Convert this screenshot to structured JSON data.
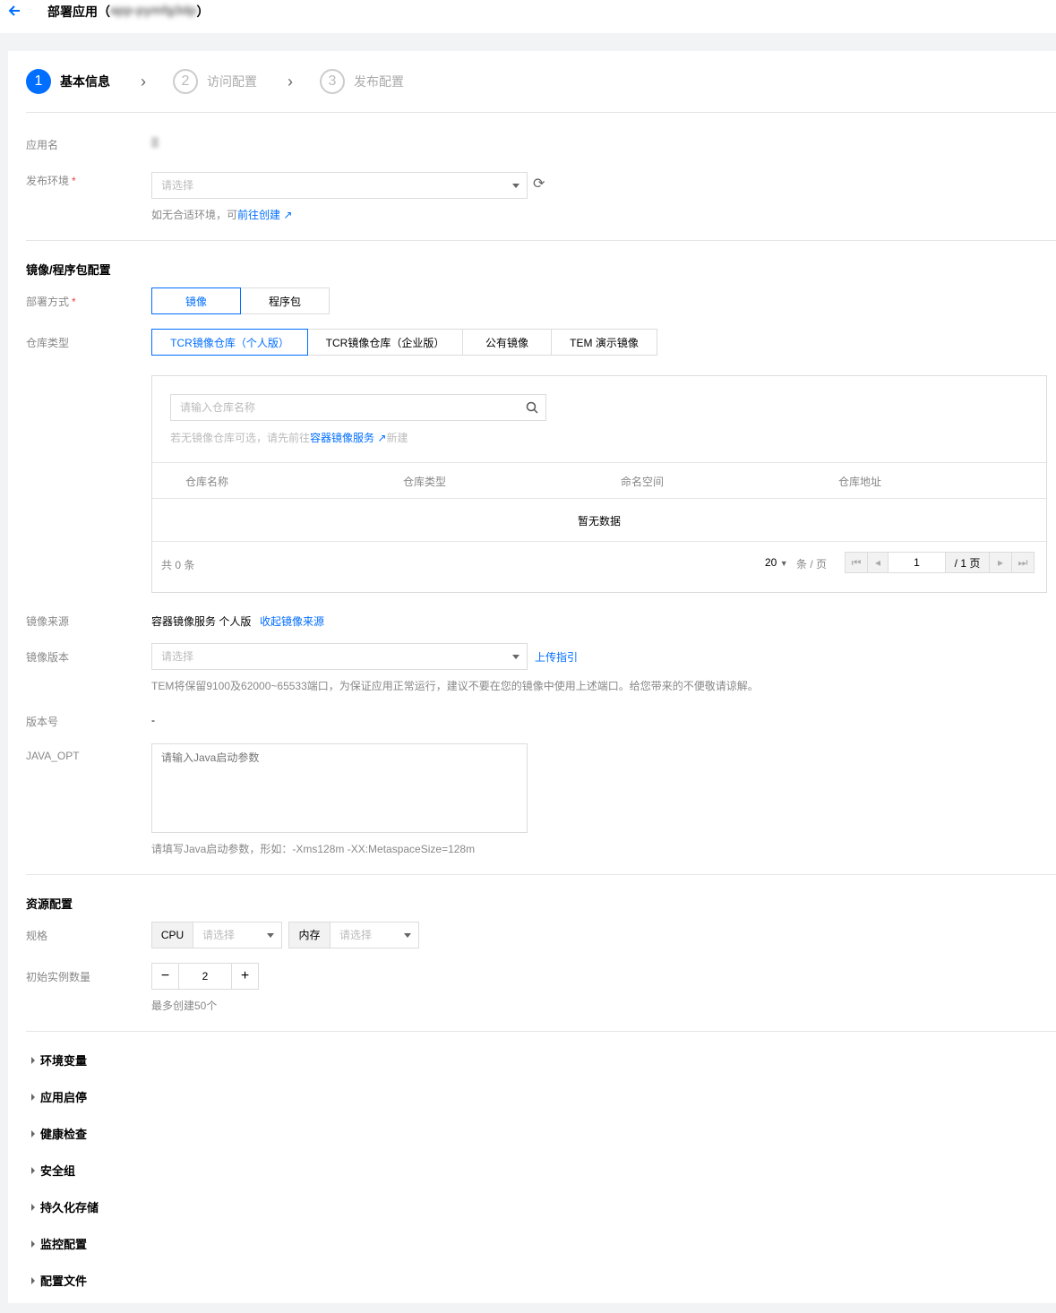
{
  "header": {
    "title": "部署应用（",
    "title_blurred": "app-pymfg3dp",
    "title_end": "）"
  },
  "steps": [
    {
      "num": "1",
      "label": "基本信息"
    },
    {
      "num": "2",
      "label": "访问配置"
    },
    {
      "num": "3",
      "label": "发布配置"
    }
  ],
  "basic": {
    "app_name_label": "应用名",
    "env_label": "发布环境",
    "env_placeholder": "请选择",
    "env_hint": "如无合适环境，可",
    "env_link": "前往创建"
  },
  "image": {
    "section_title": "镜像/程序包配置",
    "deploy_label": "部署方式",
    "deploy_options": [
      "镜像",
      "程序包"
    ],
    "repo_type_label": "仓库类型",
    "repo_types": [
      "TCR镜像仓库（个人版）",
      "TCR镜像仓库（企业版）",
      "公有镜像",
      "TEM 演示镜像"
    ],
    "search_placeholder": "请输入仓库名称",
    "search_hint_pre": "若无镜像仓库可选，请先前往",
    "search_hint_link": "容器镜像服务",
    "search_hint_post": "新建",
    "columns": [
      "仓库名称",
      "仓库类型",
      "命名空间",
      "仓库地址"
    ],
    "empty": "暂无数据",
    "total": "共 0 条",
    "page_size": "20",
    "per_page": "条 / 页",
    "page": "1",
    "page_total": "/ 1 页",
    "source_label": "镜像来源",
    "source_value": "容器镜像服务 个人版",
    "source_link": "收起镜像来源",
    "version_label": "镜像版本",
    "version_placeholder": "请选择",
    "upload_link": "上传指引",
    "port_notice": "TEM将保留9100及62000~65533端口，为保证应用正常运行，建议不要在您的镜像中使用上述端口。给您带来的不便敬请谅解。",
    "version_no_label": "版本号",
    "version_no_value": "-",
    "java_label": "JAVA_OPT",
    "java_placeholder": "请输入Java启动参数",
    "java_hint": "请填写Java启动参数，形如：-Xms128m -XX:MetaspaceSize=128m"
  },
  "resource": {
    "section_title": "资源配置",
    "spec_label": "规格",
    "cpu_label": "CPU",
    "cpu_placeholder": "请选择",
    "mem_label": "内存",
    "mem_placeholder": "请选择",
    "instances_label": "初始实例数量",
    "instances_value": "2",
    "instances_hint": "最多创建50个"
  },
  "collapsibles": [
    "环境变量",
    "应用启停",
    "健康检查",
    "安全组",
    "持久化存储",
    "监控配置",
    "配置文件"
  ]
}
